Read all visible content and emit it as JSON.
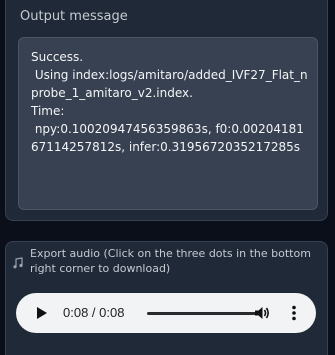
{
  "output": {
    "label": "Output message",
    "text": "Success.\n Using index:logs/amitaro/added_IVF27_Flat_nprobe_1_amitaro_v2.index.\nTime:\n npy:0.10020947456359863s, f0:0.0020418167114257812s, infer:0.3195672035217285s"
  },
  "audio": {
    "label": "Export audio (Click on the three dots in the bottom right corner to download)",
    "label_icon": "music-note-icon",
    "player": {
      "current_time": "0:08",
      "separator": " / ",
      "duration": "0:08",
      "progress": 1.0,
      "play_icon": "play-icon",
      "volume_icon": "volume-icon",
      "more_icon": "more-vertical-icon"
    }
  },
  "colors": {
    "background": "#0b0f19",
    "panel": "#1f2937",
    "textbox": "#374151",
    "player_bg": "#f1f3f4"
  }
}
